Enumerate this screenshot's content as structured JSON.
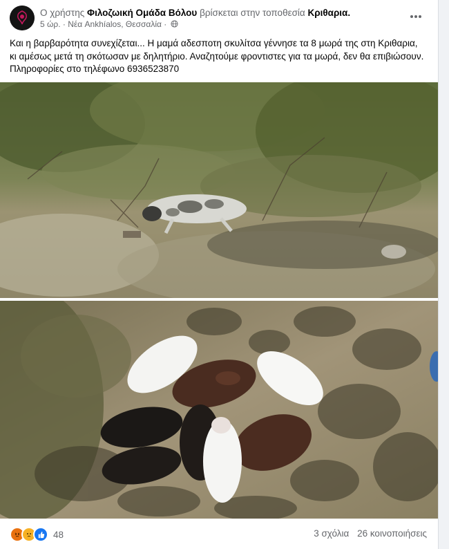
{
  "post": {
    "header": {
      "prefix": "Ο χρήστης",
      "author": "Φιλοζωική Ομάδα Βόλου",
      "middle": "βρίσκεται στην τοποθεσία",
      "location": "Κριθαρια."
    },
    "time": "5 ώρ.",
    "dot": "·",
    "place": "Νέα Ankhíalos, Θεσσαλία",
    "dot2": "·",
    "text": "Και η βαρβαρότητα συνεχίζεται... Η μαμά αδεσποτη σκυλίτσα γέννησε τα 8 μωρά της στη Κριθαρια, κι αμέσως μετά τη σκότωσαν με δηλητήριο. Αναζητούμε φροντιστες για τα μωρά, δεν θα επιβιώσουν. Πληροφορίες στο τηλέφωνο 6936523870"
  },
  "footer": {
    "reaction_icons": [
      "angry-icon",
      "sad-icon",
      "like-icon"
    ],
    "reaction_count": "48",
    "comments": "3 σχόλια",
    "shares": "26 κοινοποιήσεις"
  },
  "colors": {
    "muted": "#65676b",
    "like": "#1877f2",
    "angry": "#e9710f",
    "sad": "#f7b125"
  }
}
